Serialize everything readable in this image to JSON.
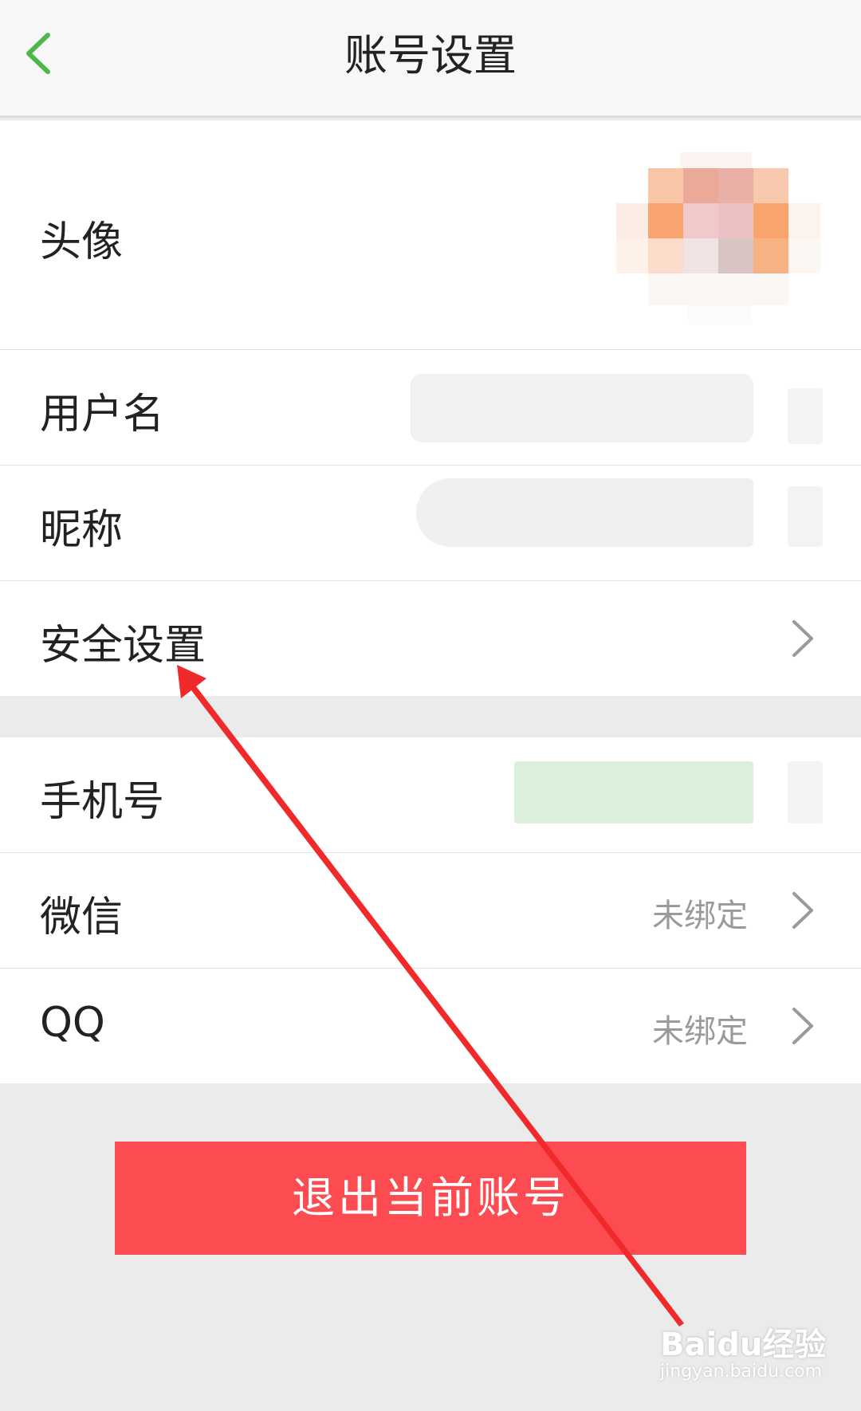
{
  "header": {
    "title": "账号设置",
    "back_icon": "chevron-left-icon"
  },
  "account_group": {
    "rows": [
      {
        "label": "头像"
      },
      {
        "label": "用户名"
      },
      {
        "label": "昵称"
      },
      {
        "label": "安全设置"
      }
    ]
  },
  "binding_group": {
    "rows": [
      {
        "label": "手机号"
      },
      {
        "label": "微信",
        "value": "未绑定"
      },
      {
        "label": "QQ",
        "value": "未绑定"
      }
    ]
  },
  "logout_button": "退出当前账号",
  "watermark": {
    "brand": "Baidu经验",
    "domain": "jingyan.baidu.com"
  },
  "colors": {
    "accent_green": "#4cb849",
    "logout_red": "#fc4c52",
    "annotation_arrow": "#f02a2a"
  }
}
